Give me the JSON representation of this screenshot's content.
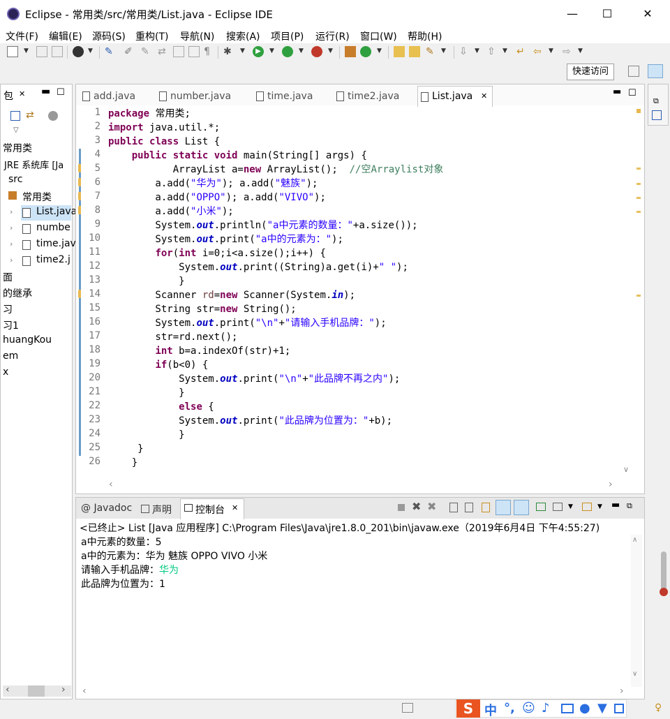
{
  "window": {
    "title": "Eclipse - 常用类/src/常用类/List.java - Eclipse IDE",
    "minimize": "—",
    "maximize": "☐",
    "close": "✕"
  },
  "menubar": {
    "items": [
      "文件(F)",
      "编辑(E)",
      "源码(S)",
      "重构(T)",
      "导航(N)",
      "搜索(A)",
      "项目(P)",
      "运行(R)",
      "窗口(W)",
      "帮助(H)"
    ]
  },
  "toolbar": {
    "quick_access": "快速访问"
  },
  "explorer": {
    "tab_label": "包",
    "items": [
      "常用类",
      "JRE 系统库 [Ja",
      "src",
      "常用类",
      "List.java",
      "numbe",
      "time.jav",
      "time2.j",
      "面",
      "的继承",
      "习",
      "习1",
      "huangKou",
      "em",
      "x"
    ]
  },
  "editor": {
    "tabs": [
      "add.java",
      "number.java",
      "time.java",
      "time2.java",
      "List.java"
    ],
    "active_tab": "List.java",
    "line_numbers": [
      "1",
      "2",
      "3",
      "4",
      "5",
      "6",
      "7",
      "8",
      "9",
      "10",
      "11",
      "12",
      "13",
      "14",
      "15",
      "16",
      "17",
      "18",
      "19",
      "20",
      "21",
      "22",
      "23",
      "24",
      "25",
      "26"
    ]
  },
  "console": {
    "tabs": [
      "Javadoc",
      "声明",
      "控制台"
    ],
    "active_tab": "控制台",
    "header": "<已终止> List [Java 应用程序] C:\\Program Files\\Java\\jre1.8.0_201\\bin\\javaw.exe（2019年6月4日 下午4:55:27)",
    "lines": [
      "a中元素的数量：5",
      "a中的元素为：华为 魅族 OPPO VIVO 小米 ",
      "请输入手机品牌：",
      "此品牌为位置为：1"
    ],
    "user_input": "华为"
  },
  "colors": {
    "keyword": "#7f0055",
    "string": "#2a00ff",
    "comment": "#3f7f5f",
    "static_field": "#0000c0",
    "current_line": "#e8f2fe",
    "input_green": "#00c87f"
  },
  "ime": {
    "logo": "S",
    "mode": "中"
  }
}
